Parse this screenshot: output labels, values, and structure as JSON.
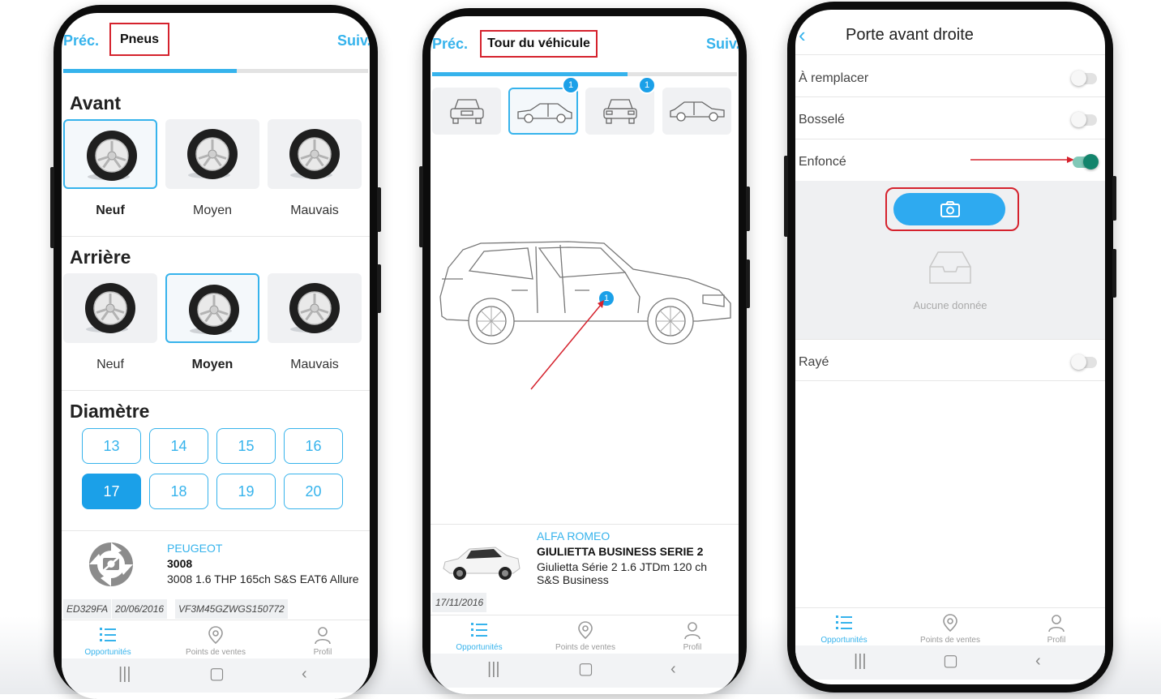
{
  "phone1": {
    "nav_prev": "Préc.",
    "title": "Pneus",
    "nav_next": "Suiv.",
    "progress": 0.57,
    "section_avant": "Avant",
    "avant_options": [
      {
        "label": "Neuf",
        "selected": true
      },
      {
        "label": "Moyen",
        "selected": false
      },
      {
        "label": "Mauvais",
        "selected": false
      }
    ],
    "section_arriere": "Arrière",
    "arriere_options": [
      {
        "label": "Neuf",
        "selected": false
      },
      {
        "label": "Moyen",
        "selected": true
      },
      {
        "label": "Mauvais",
        "selected": false
      }
    ],
    "section_diametre": "Diamètre",
    "diameters": [
      "13",
      "14",
      "15",
      "16",
      "17",
      "18",
      "19",
      "20"
    ],
    "selected_diameter": "17",
    "vehicle": {
      "brand": "PEUGEOT",
      "model": "3008",
      "version": "3008 1.6 THP 165ch S&S EAT6 Allure",
      "tags": [
        "ED329FA",
        "20/06/2016",
        "VF3M45GZWGS150772"
      ]
    }
  },
  "phone2": {
    "nav_prev": "Préc.",
    "title": "Tour du véhicule",
    "nav_next": "Suiv.",
    "progress": 0.64,
    "thumb_badges": [
      "1",
      "1"
    ],
    "door_badge": "1",
    "vehicle": {
      "brand": "ALFA ROMEO",
      "model": "GIULIETTA BUSINESS SERIE 2",
      "version": "Giulietta Série 2 1.6 JTDm 120 ch S&S Business",
      "date": "17/11/2016"
    }
  },
  "phone3": {
    "back_icon": "chevron-left-icon",
    "title": "Porte avant droite",
    "options": [
      {
        "label": "À remplacer",
        "on": false
      },
      {
        "label": "Bosselé",
        "on": false
      },
      {
        "label": "Enfoncé",
        "on": true
      },
      {
        "label": "Rayé",
        "on": false
      }
    ],
    "camera_icon": "camera-icon",
    "empty_text": "Aucune donnée"
  },
  "tabbar": {
    "tabs": [
      "Opportunités",
      "Points de ventes",
      "Profil"
    ]
  },
  "colors": {
    "accent": "#36b3ec",
    "selected_chip": "#1ba0e8",
    "annotation_red": "#d5222d",
    "toggle_on": "#13846c"
  }
}
